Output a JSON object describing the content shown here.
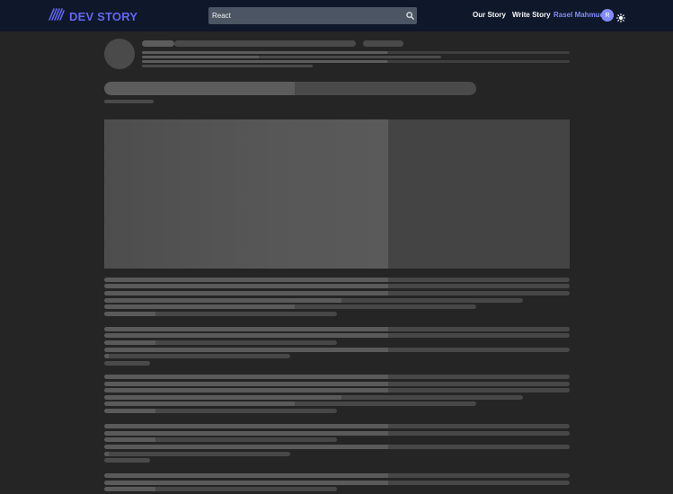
{
  "navbar": {
    "brand": "DEV STORY",
    "search": {
      "value": "React"
    },
    "links": {
      "our_story": "Our Story",
      "write_story": "Write Story"
    },
    "user": {
      "name": "Rasel Mahmud",
      "initial": "R"
    }
  },
  "icons": {
    "logo": "dev-story-logo-icon",
    "search": "search-icon",
    "theme": "sun-icon"
  },
  "colors": {
    "navbar_bg": "#0f172a",
    "brand": "#6366f1",
    "user": "#818cf8",
    "page_bg": "#252525"
  }
}
